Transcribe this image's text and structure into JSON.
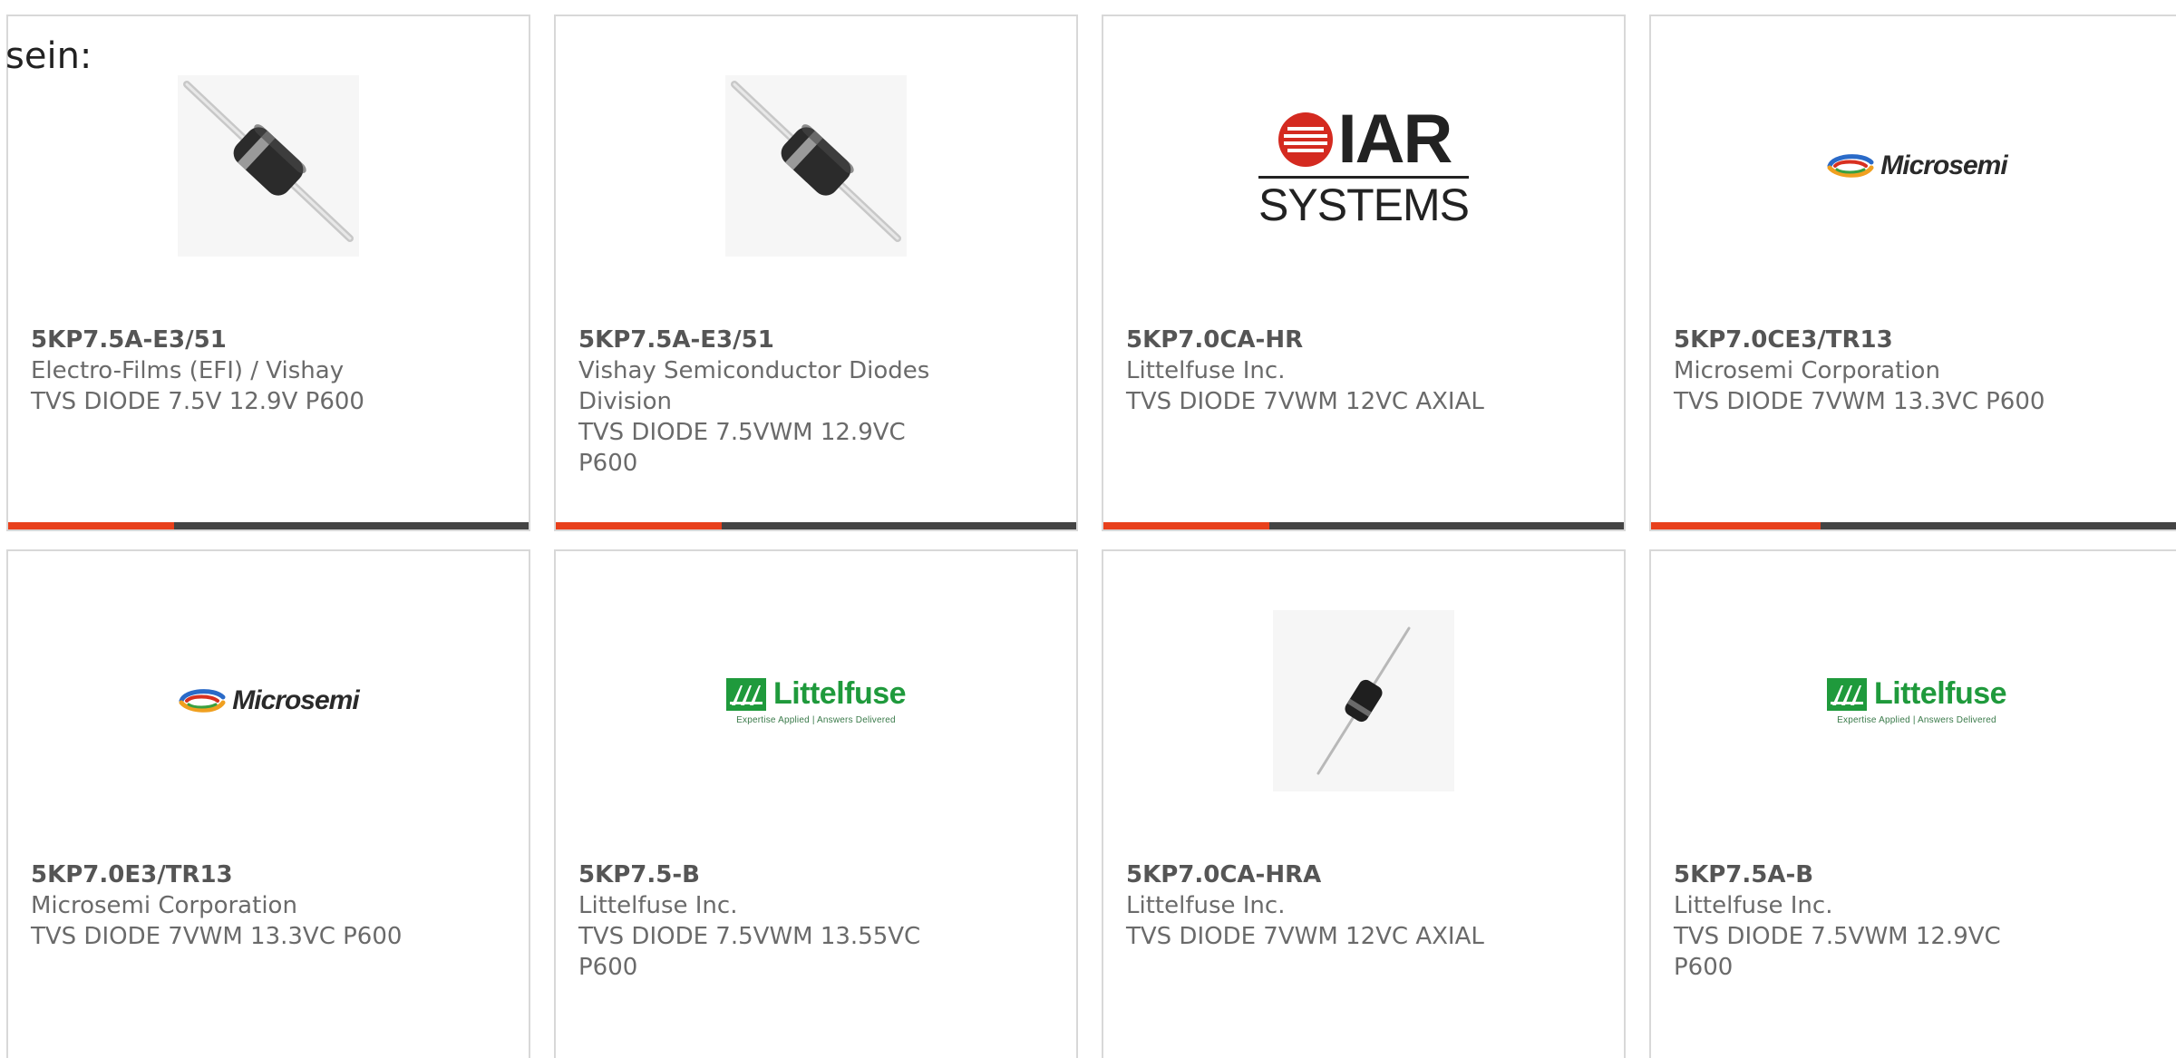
{
  "intro": {
    "text": "sein:"
  },
  "colors": {
    "accent": "#e8401c",
    "progress_track": "#444444",
    "card_border": "#d8d8d8",
    "microsemi_brand": "#2a2a2a",
    "littelfuse_green": "#1f9a3c",
    "iar_red": "#d42a20"
  },
  "products": [
    {
      "part_number": "5KP7.5A-E3/51",
      "manufacturer": "Electro-Films (EFI) / Vishay",
      "description": "TVS DIODE 7.5V 12.9V P600",
      "image": "diode-axial-icon",
      "progress": 0.32
    },
    {
      "part_number": "5KP7.5A-E3/51",
      "manufacturer": "Vishay Semiconductor Diodes Division",
      "description": "TVS DIODE 7.5VWM 12.9VC P600",
      "image": "diode-axial-icon",
      "progress": 0.32
    },
    {
      "part_number": "5KP7.0CA-HR",
      "manufacturer": "Littelfuse Inc.",
      "description": "TVS DIODE 7VWM 12VC AXIAL",
      "image": "iar-systems-logo",
      "logo_text_top": "IAR",
      "logo_text_bottom": "SYSTEMS",
      "progress": 0.32
    },
    {
      "part_number": "5KP7.0CE3/TR13",
      "manufacturer": "Microsemi Corporation",
      "description": "TVS DIODE 7VWM 13.3VC P600",
      "image": "microsemi-logo",
      "logo_text": "Microsemi",
      "progress": 0.32
    },
    {
      "part_number": "5KP7.0E3/TR13",
      "manufacturer": "Microsemi Corporation",
      "description": "TVS DIODE 7VWM 13.3VC P600",
      "image": "microsemi-logo",
      "logo_text": "Microsemi"
    },
    {
      "part_number": "5KP7.5-B",
      "manufacturer": "Littelfuse Inc.",
      "description": "TVS DIODE 7.5VWM 13.55VC P600",
      "image": "littelfuse-logo",
      "logo_text": "Littelfuse",
      "logo_tagline": "Expertise Applied | Answers Delivered"
    },
    {
      "part_number": "5KP7.0CA-HRA",
      "manufacturer": "Littelfuse Inc.",
      "description": "TVS DIODE 7VWM 12VC AXIAL",
      "image": "diode-axial-small-icon"
    },
    {
      "part_number": "5KP7.5A-B",
      "manufacturer": "Littelfuse Inc.",
      "description": "TVS DIODE 7.5VWM 12.9VC P600",
      "image": "littelfuse-logo",
      "logo_text": "Littelfuse",
      "logo_tagline": "Expertise Applied | Answers Delivered"
    }
  ]
}
